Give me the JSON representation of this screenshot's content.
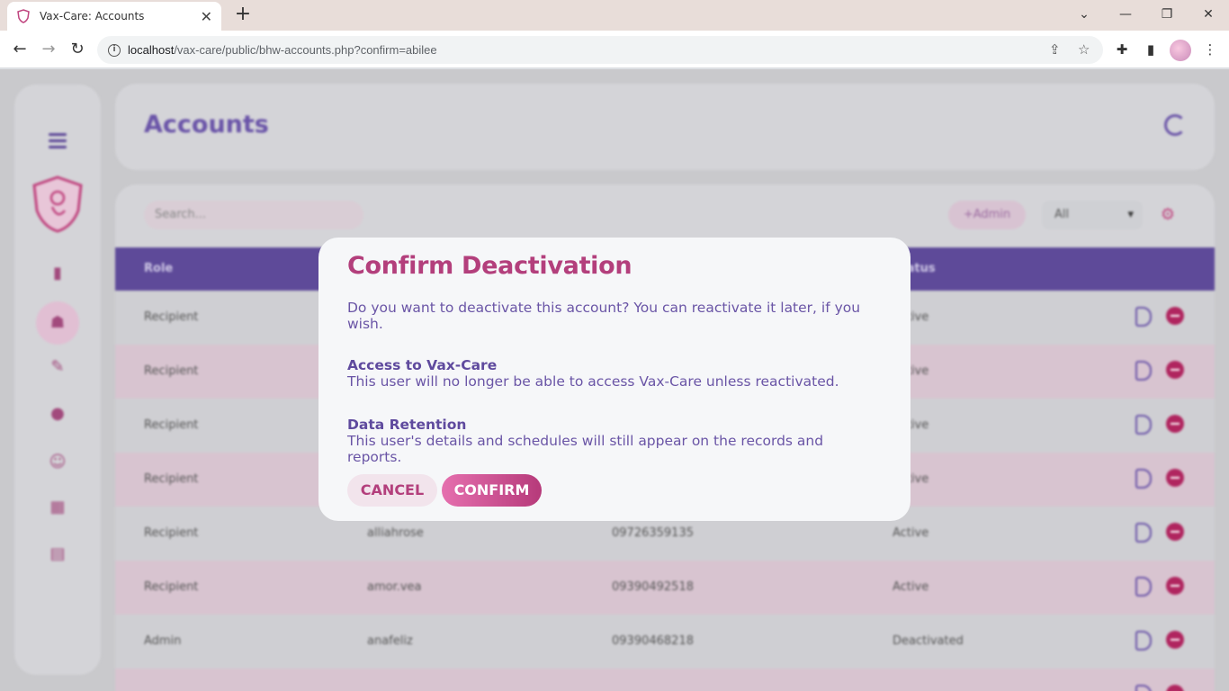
{
  "browser": {
    "tab_title": "Vax-Care: Accounts",
    "url_host": "localhost",
    "url_path": "/vax-care/public/bhw-accounts.php?confirm=abilee"
  },
  "sidebar": {
    "items": [
      "menu-icon",
      "stats-icon",
      "accounts-icon",
      "vaccine-icon",
      "health-worker-icon",
      "baby-icon",
      "calendar-icon",
      "report-icon"
    ]
  },
  "header": {
    "title": "Accounts"
  },
  "toolbar": {
    "search_placeholder": "Search...",
    "add_admin_label": "+Admin",
    "filter_value": "All"
  },
  "table": {
    "columns": [
      "Role",
      "",
      "",
      "Status"
    ],
    "rows": [
      {
        "role": "Recipient",
        "username": "",
        "contact": "",
        "status": "Active"
      },
      {
        "role": "Recipient",
        "username": "",
        "contact": "",
        "status": "Active"
      },
      {
        "role": "Recipient",
        "username": "",
        "contact": "",
        "status": "Active"
      },
      {
        "role": "Recipient",
        "username": "",
        "contact": "",
        "status": "Active"
      },
      {
        "role": "Recipient",
        "username": "alliahrose",
        "contact": "09726359135",
        "status": "Active"
      },
      {
        "role": "Recipient",
        "username": "amor.vea",
        "contact": "09390492518",
        "status": "Active"
      },
      {
        "role": "Admin",
        "username": "anafeliz",
        "contact": "09390468218",
        "status": "Deactivated"
      }
    ]
  },
  "modal": {
    "title": "Confirm Deactivation",
    "lead": "Do you want to deactivate this account? You can reactivate it later, if you wish.",
    "section1_title": "Access to Vax-Care",
    "section1_text": "This user will no longer be able to access Vax-Care unless reactivated.",
    "section2_title": "Data Retention",
    "section2_text": "This user's details and schedules will still appear on the records and reports.",
    "cancel_label": "CANCEL",
    "confirm_label": "CONFIRM"
  },
  "colors": {
    "primary_purple": "#6a54a8",
    "accent_pink": "#b33f7c",
    "table_header": "#5e4a99"
  }
}
